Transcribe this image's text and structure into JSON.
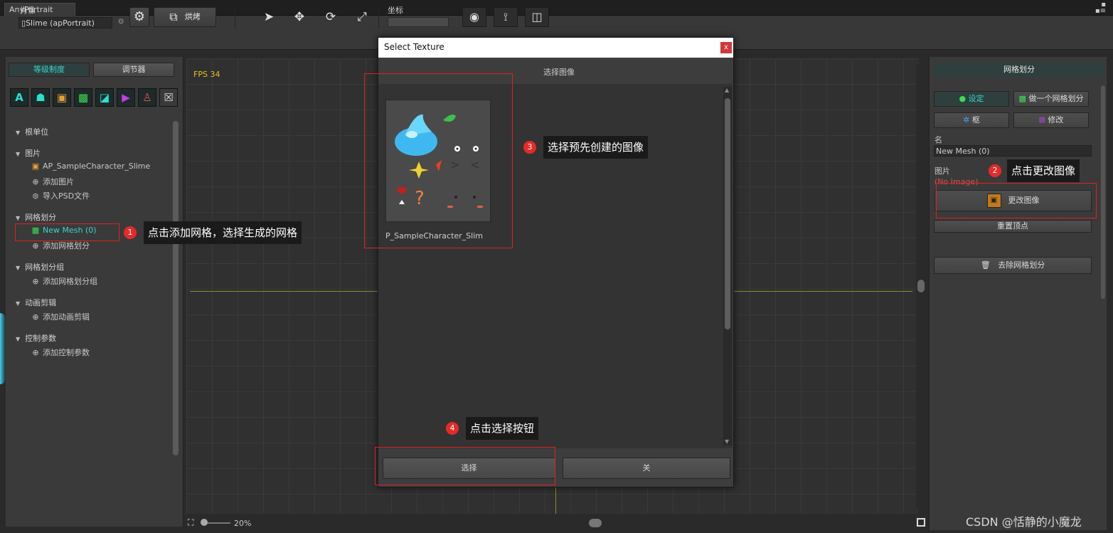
{
  "window": {
    "title": "AnyPortrait"
  },
  "toolbar": {
    "portrait_label": "肖像",
    "portrait_value": "Slime (apPortrait)",
    "bake_label": "烘烤",
    "coord_label": "坐标"
  },
  "left_panel": {
    "tab_hierarchy": "等级制度",
    "tab_controller": "调节器",
    "icons": [
      "text-icon",
      "character-icon",
      "image-icon",
      "mesh-icon",
      "mesh-group-icon",
      "animation-icon",
      "param-icon",
      "close-box-icon"
    ],
    "sections": {
      "root": {
        "label": "根单位"
      },
      "image": {
        "label": "图片",
        "items": [
          "AP_SampleCharacter_Slime",
          "添加图片",
          "导入PSD文件"
        ]
      },
      "mesh": {
        "label": "网格划分",
        "items": [
          "New Mesh (0)",
          "添加网格划分"
        ]
      },
      "mesh_group": {
        "label": "网格划分组",
        "items": [
          "添加网格划分组"
        ]
      },
      "animation": {
        "label": "动画剪辑",
        "items": [
          "添加动画剪辑"
        ]
      },
      "control": {
        "label": "控制参数",
        "items": [
          "添加控制参数"
        ]
      }
    }
  },
  "canvas": {
    "fps": "FPS 34",
    "zoom": "20%"
  },
  "right_panel": {
    "header": "网格划分",
    "setting": "设定",
    "make_mesh": "做一个网格划分",
    "frame": "枢",
    "modify": "修改",
    "name_label": "名",
    "name_value": "New Mesh (0)",
    "image_label": "图片",
    "no_image": "(No Image)",
    "change_image": "更改图像",
    "reset_vertices": "重置顶点",
    "remove_mesh": "去除网格划分"
  },
  "dialog": {
    "title": "Select Texture",
    "close_x": "x",
    "subtitle": "选择图像",
    "thumbnail_caption": "P_SampleCharacter_Slim",
    "select_button": "选择",
    "close_button": "关"
  },
  "annotations": {
    "n1": "1",
    "t1": "点击添加网格，选择生成的网格",
    "n2": "2",
    "t2": "点击更改图像",
    "n3": "3",
    "t3": "选择预先创建的图像",
    "n4": "4",
    "t4": "点击选择按钮"
  },
  "watermark": "CSDN @恬静的小魔龙",
  "colors": {
    "accent": "#38d4c8",
    "annotation_red": "#e62a2a",
    "fps": "#e8c21a"
  }
}
